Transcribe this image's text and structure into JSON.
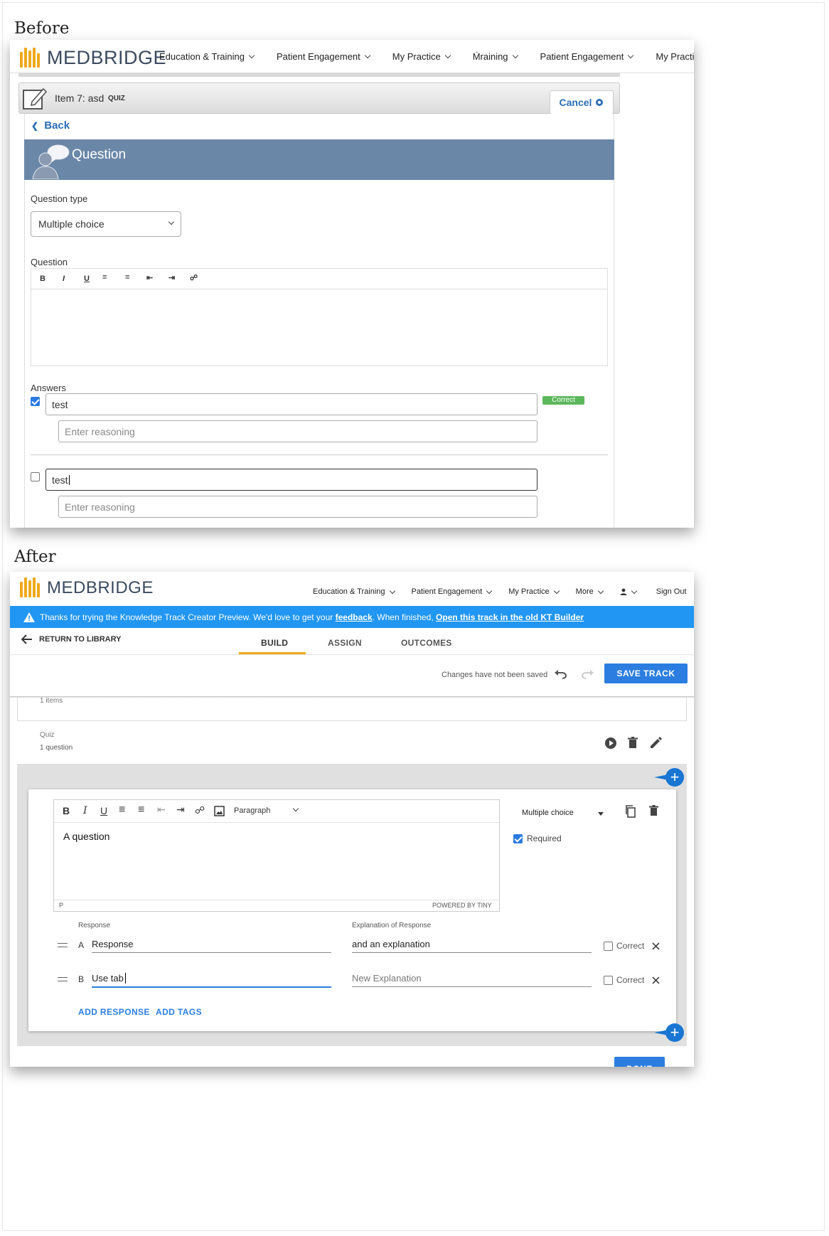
{
  "before": {
    "section_label": "Before",
    "logo_text": "MEDBRIDGE",
    "nav": [
      "Education & Training",
      "Patient Engagement",
      "My Practice",
      "Ḿraining",
      "Patient Engagement",
      "My Practice"
    ],
    "item_title": "Item 7: asd",
    "item_type": "QUIZ",
    "cancel_label": "Cancel",
    "back_label": "Back",
    "header_title": "Question",
    "question_type_label": "Question type",
    "question_type_value": "Multiple choice",
    "question_label": "Question",
    "toolbar": [
      "B",
      "I",
      "U",
      "bulleted-list",
      "numbered-list",
      "outdent",
      "indent",
      "link"
    ],
    "answers_label": "Answers",
    "answers": [
      {
        "text": "test",
        "checked": true,
        "badge": "Correct",
        "reasoning_placeholder": "Enter reasoning"
      },
      {
        "text": "test",
        "checked": false,
        "reasoning_placeholder": "Enter reasoning"
      }
    ]
  },
  "after": {
    "section_label": "After",
    "logo_text": "MEDBRIDGE",
    "nav": [
      "Education & Training",
      "Patient Engagement",
      "My Practice",
      "More"
    ],
    "sign_out": "Sign Out",
    "banner": {
      "text_before": "Thanks for trying the Knowledge Track Creator Preview. We'd love to get your",
      "feedback_link": "feedback",
      "text_middle": ". When finished,",
      "old_builder_link": "Open this track in the old KT Builder"
    },
    "return_label": "RETURN TO LIBRARY",
    "tabs": [
      "BUILD",
      "ASSIGN",
      "OUTCOMES"
    ],
    "active_tab": "BUILD",
    "save_status": "Changes have not been saved",
    "save_button": "SAVE TRACK",
    "items_count": "1 items",
    "quiz_label": "Quiz",
    "quiz_count": "1 question",
    "editor": {
      "format": "Paragraph",
      "content": "A question",
      "path": "P",
      "powered": "POWERED BY TINY"
    },
    "question_type": "Multiple choice",
    "required_label": "Required",
    "response_header": "Response",
    "explanation_header": "Explanation of Response",
    "responses": [
      {
        "letter": "A",
        "value": "Response",
        "explanation": "and an explanation",
        "correct_label": "Correct"
      },
      {
        "letter": "B",
        "value": "Use tab",
        "explanation_placeholder": "New Explanation",
        "correct_label": "Correct"
      }
    ],
    "add_response": "ADD RESPONSE",
    "add_tags": "ADD TAGS",
    "done_button": "DONE"
  }
}
